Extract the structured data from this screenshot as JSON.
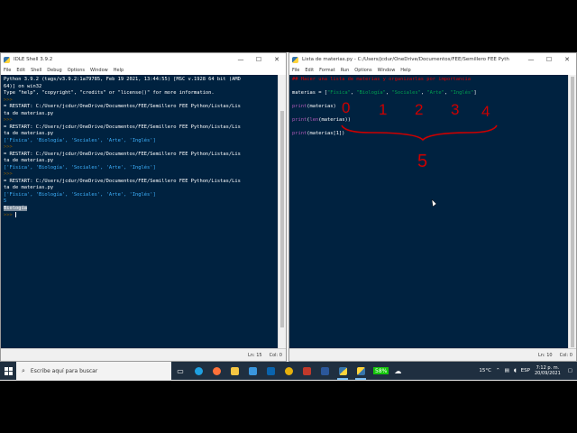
{
  "shell": {
    "title": "IDLE Shell 3.9.2",
    "menu": [
      "File",
      "Edit",
      "Shell",
      "Debug",
      "Options",
      "Window",
      "Help"
    ],
    "lines": [
      {
        "t": "Python 3.9.2 (tags/v3.9.2:1a79785, Feb 19 2021, 13:44:55) [MSC v.1928 64 bit (AMD",
        "c": "c-err"
      },
      {
        "t": "64)] on win32",
        "c": "c-err"
      },
      {
        "t": "Type \"help\", \"copyright\", \"credits\" or \"license()\" for more information.",
        "c": "c-err"
      },
      {
        "t": ">>> ",
        "c": "c-prompt"
      },
      {
        "t": "= RESTART: C:/Users/jcdur/OneDrive/Documentos/FEE/Semillero FEE Python/Listas/Lis",
        "c": "c-restart"
      },
      {
        "t": "ta de materias.py",
        "c": "c-restart"
      },
      {
        "t": ">>> ",
        "c": "c-prompt"
      },
      {
        "t": "= RESTART: C:/Users/jcdur/OneDrive/Documentos/FEE/Semillero FEE Python/Listas/Lis",
        "c": "c-restart"
      },
      {
        "t": "ta de materias.py",
        "c": "c-restart"
      },
      {
        "t": "['Física', 'Biología', 'Sociales', 'Arte', 'Inglés']",
        "c": "c-output"
      },
      {
        "t": ">>> ",
        "c": "c-prompt"
      },
      {
        "t": "= RESTART: C:/Users/jcdur/OneDrive/Documentos/FEE/Semillero FEE Python/Listas/Lis",
        "c": "c-restart"
      },
      {
        "t": "ta de materias.py",
        "c": "c-restart"
      },
      {
        "t": "['Física', 'Biología', 'Sociales', 'Arte', 'Inglés']",
        "c": "c-output"
      },
      {
        "t": ">>> ",
        "c": "c-prompt"
      },
      {
        "t": "= RESTART: C:/Users/jcdur/OneDrive/Documentos/FEE/Semillero FEE Python/Listas/Lis",
        "c": "c-restart"
      },
      {
        "t": "ta de materias.py",
        "c": "c-restart"
      },
      {
        "t": "['Física', 'Biología', 'Sociales', 'Arte', 'Inglés']",
        "c": "c-output"
      },
      {
        "t": "5",
        "c": "c-output"
      },
      {
        "t": "Biología",
        "c": "c-hl"
      },
      {
        "t": ">>> ",
        "c": "c-prompt"
      }
    ],
    "status_ln": "Ln: 15",
    "status_col": "Col: 0"
  },
  "editor": {
    "title": "Lista de materias.py - C:/Users/jcdur/OneDrive/Documentos/FEE/Semillero FEE Python/Listas/Li...",
    "menu": [
      "File",
      "Edit",
      "Format",
      "Run",
      "Options",
      "Window",
      "Help"
    ],
    "comment": "## Hacer una lista de materias y organizarlas por importancia",
    "assign_prefix": "materias = [",
    "list_items": [
      "\"Física\"",
      "\"Biología\"",
      "\"Sociales\"",
      "\"Arte\"",
      "\"Inglés\""
    ],
    "print1_fn": "print",
    "print1_arg": "(materias)",
    "print2_fn": "print",
    "print2_mid": "(",
    "print2_len": "len",
    "print2_arg": "(materias))",
    "print3_fn": "print",
    "print3_arg": "(materias[1])",
    "status_ln": "Ln: 10",
    "status_col": "Col: 0",
    "annotations": {
      "indices": [
        "0",
        "1",
        "2",
        "3",
        "4"
      ],
      "count": "5"
    }
  },
  "window_controls": [
    "—",
    "☐",
    "✕"
  ],
  "taskbar": {
    "search_placeholder": "Escribe aquí para buscar",
    "battery": "58%",
    "temperature": "15°C",
    "language": "ESP",
    "time": "7:12 p. m.",
    "date": "20/09/2021"
  }
}
